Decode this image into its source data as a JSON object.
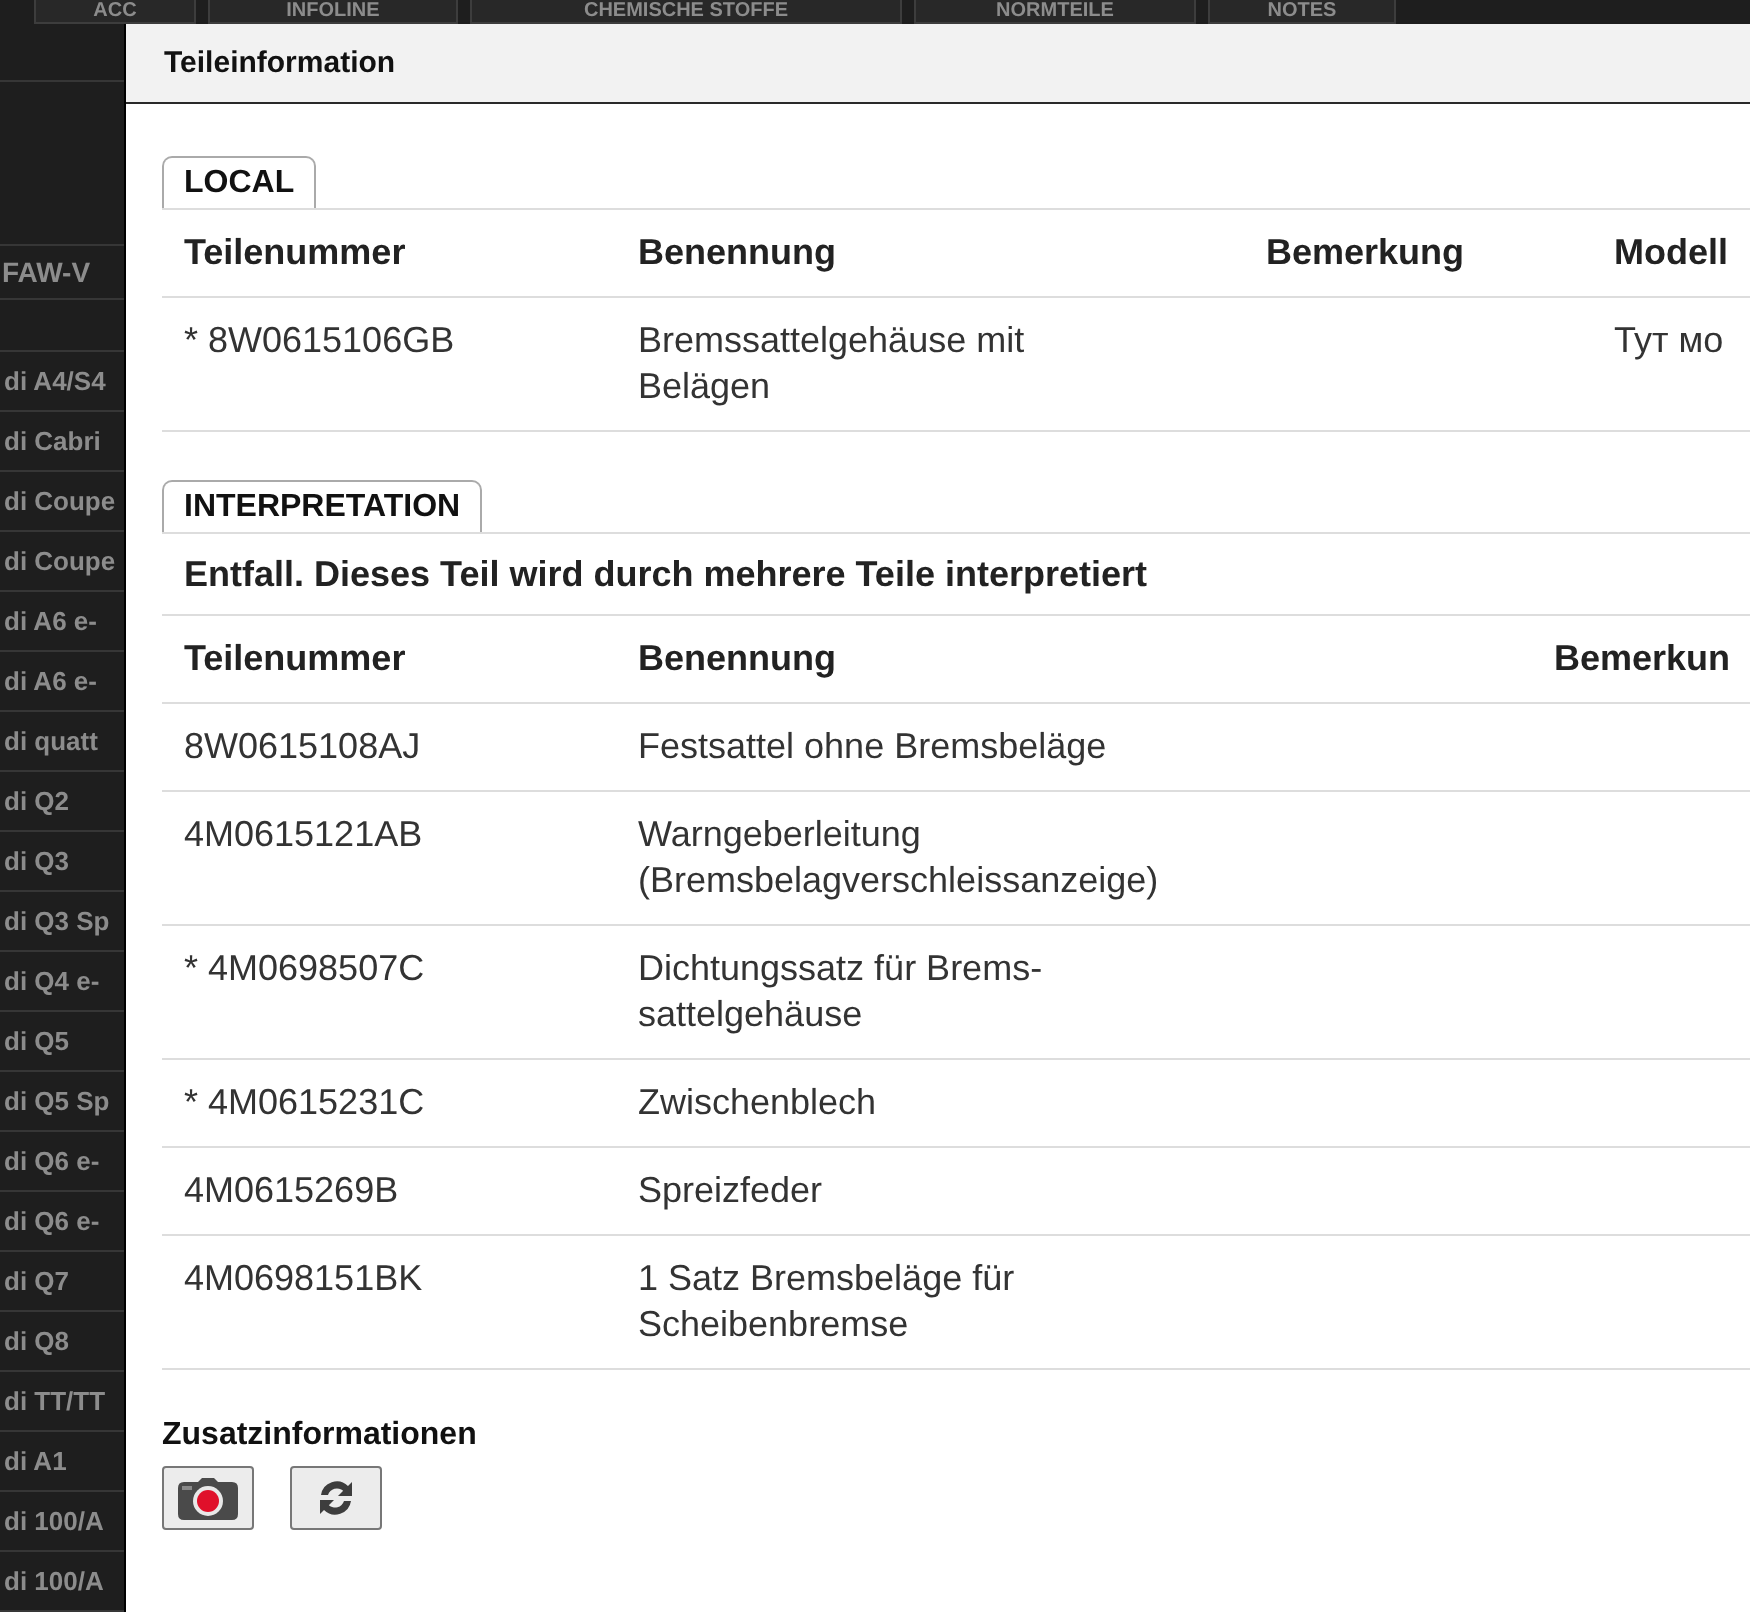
{
  "background": {
    "tabs": [
      "ACC",
      "INFOLINE",
      "CHEMISCHE STOFFE",
      "NORMTEILE",
      "NOTES"
    ],
    "sidebar": {
      "header": "FAW-V",
      "items": [
        "di A4/S4",
        "di Cabri",
        "di Coupe",
        "di Coupe",
        "di A6 e-",
        "di A6 e-",
        "di quatt",
        "di Q2",
        "di Q3",
        "di Q3 Sp",
        "di Q4 e-",
        "di Q5",
        "di Q5 Sp",
        "di Q6 e-",
        "di Q6 e-",
        "di Q7",
        "di Q8",
        "di TT/TT",
        "di A1",
        "di 100/A",
        "di 100/A"
      ]
    }
  },
  "dialog": {
    "title": "Teileinformation",
    "sections": [
      {
        "label": "LOCAL",
        "columns": [
          "Teilenummer",
          "Benennung",
          "Bemerkung",
          "Modell"
        ],
        "rows": [
          {
            "number": "* 8W0615106GB",
            "name": "Bremssattelgehäuse mit Belägen",
            "model": "Тут мо"
          }
        ]
      },
      {
        "label": "INTERPRETATION",
        "note": "Entfall. Dieses Teil wird durch mehrere Teile interpretiert",
        "columns": [
          "Teilenummer",
          "Benennung",
          "Bemerkun"
        ],
        "rows": [
          {
            "number": "8W0615108AJ",
            "name": "Festsattel ohne Bremsbeläge"
          },
          {
            "number": "4M0615121AB",
            "name": "Warngeberleitung (Bremsbelagverschleissanzeige)"
          },
          {
            "number": "* 4M0698507C",
            "name": "Dichtungssatz für Brems-sattelgehäuse"
          },
          {
            "number": "* 4M0615231C",
            "name": "Zwischenblech"
          },
          {
            "number": "4M0615269B",
            "name": "Spreizfeder"
          },
          {
            "number": "4M0698151BK",
            "name": "1 Satz Bremsbeläge für Scheibenbremse"
          }
        ]
      }
    ],
    "extra": {
      "heading": "Zusatzinformationen",
      "buttons": [
        {
          "kind": "camera"
        },
        {
          "kind": "refresh"
        }
      ]
    }
  }
}
